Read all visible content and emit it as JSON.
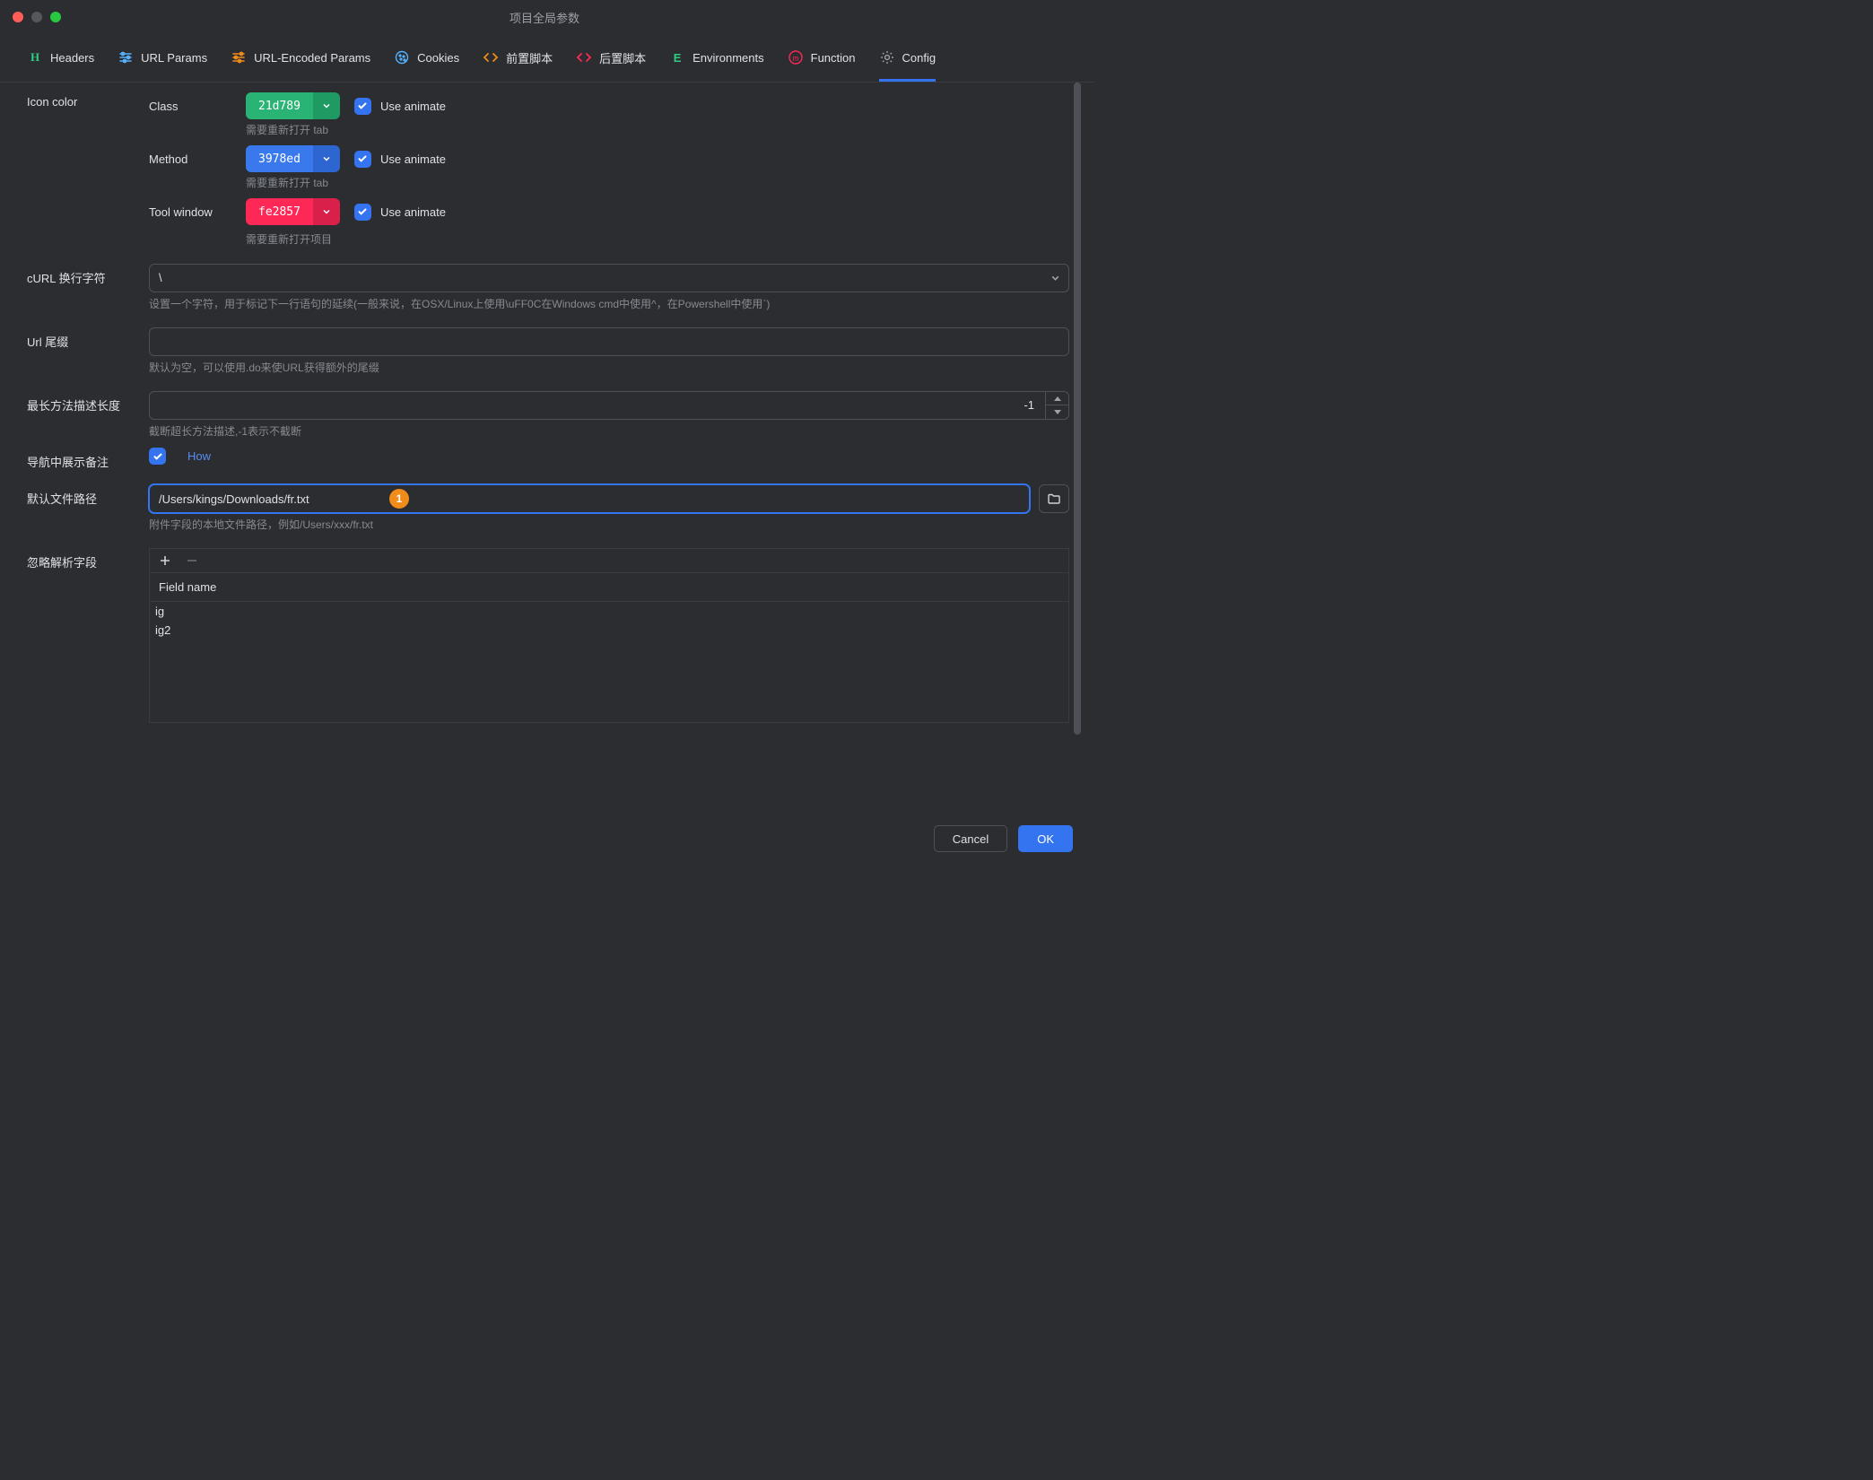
{
  "window": {
    "title": "项目全局参数"
  },
  "tabs": [
    {
      "id": "headers",
      "label": "Headers",
      "icon": "headers-icon",
      "color": "#2ecf82"
    },
    {
      "id": "url-params",
      "label": "URL Params",
      "icon": "sliders-icon",
      "color": "#55b0ff"
    },
    {
      "id": "url-enc",
      "label": "URL-Encoded Params",
      "icon": "sliders-alt-icon",
      "color": "#f08c1a"
    },
    {
      "id": "cookies",
      "label": "Cookies",
      "icon": "cookie-icon",
      "color": "#55b0ff"
    },
    {
      "id": "pre-script",
      "label": "前置脚本",
      "icon": "code-icon",
      "color": "#f08c1a"
    },
    {
      "id": "post-script",
      "label": "后置脚本",
      "icon": "code-icon",
      "color": "#fe2857"
    },
    {
      "id": "env",
      "label": "Environments",
      "icon": "env-icon",
      "color": "#2ecf82"
    },
    {
      "id": "function",
      "label": "Function",
      "icon": "function-icon",
      "color": "#fe2857"
    },
    {
      "id": "config",
      "label": "Config",
      "icon": "gear-icon",
      "color": "#9da0a8",
      "active": true
    }
  ],
  "config": {
    "icon_color": {
      "section_label": "Icon color",
      "rows": {
        "class": {
          "label": "Class",
          "value": "21d789",
          "animate_label": "Use animate",
          "animate": true
        },
        "method": {
          "label": "Method",
          "value": "3978ed",
          "animate_label": "Use animate",
          "animate": true,
          "hint": "需要重新打开 tab"
        },
        "tool_window": {
          "label": "Tool window",
          "value": "fe2857",
          "animate_label": "Use animate",
          "animate": true,
          "hint_top": "需要重新打开 tab",
          "hint_bottom": "需要重新打开项目"
        }
      }
    },
    "curl_newline": {
      "label": "cURL 换行字符",
      "value": "\\",
      "hint": "设置一个字符，用于标记下一行语句的延续(一般来说，在OSX/Linux上使用\\uFF0C在Windows cmd中使用^，在Powershell中使用`)"
    },
    "url_suffix": {
      "label": "Url 尾缀",
      "value": "",
      "hint": "默认为空，可以使用.do来使URL获得额外的尾缀"
    },
    "max_method_len": {
      "label": "最长方法描述长度",
      "value": "-1",
      "hint": "截断超长方法描述,-1表示不截断"
    },
    "show_remark": {
      "label": "导航中展示备注",
      "checked": true,
      "link": "How"
    },
    "default_file": {
      "label": "默认文件路径",
      "value": "/Users/kings/Downloads/fr.txt",
      "hint": "附件字段的本地文件路径，例如/Users/xxx/fr.txt",
      "badge": "1"
    },
    "ignore_fields": {
      "label": "忽略解析字段",
      "column": "Field name",
      "rows": [
        "ig",
        "ig2"
      ]
    }
  },
  "footer": {
    "cancel": "Cancel",
    "ok": "OK"
  }
}
